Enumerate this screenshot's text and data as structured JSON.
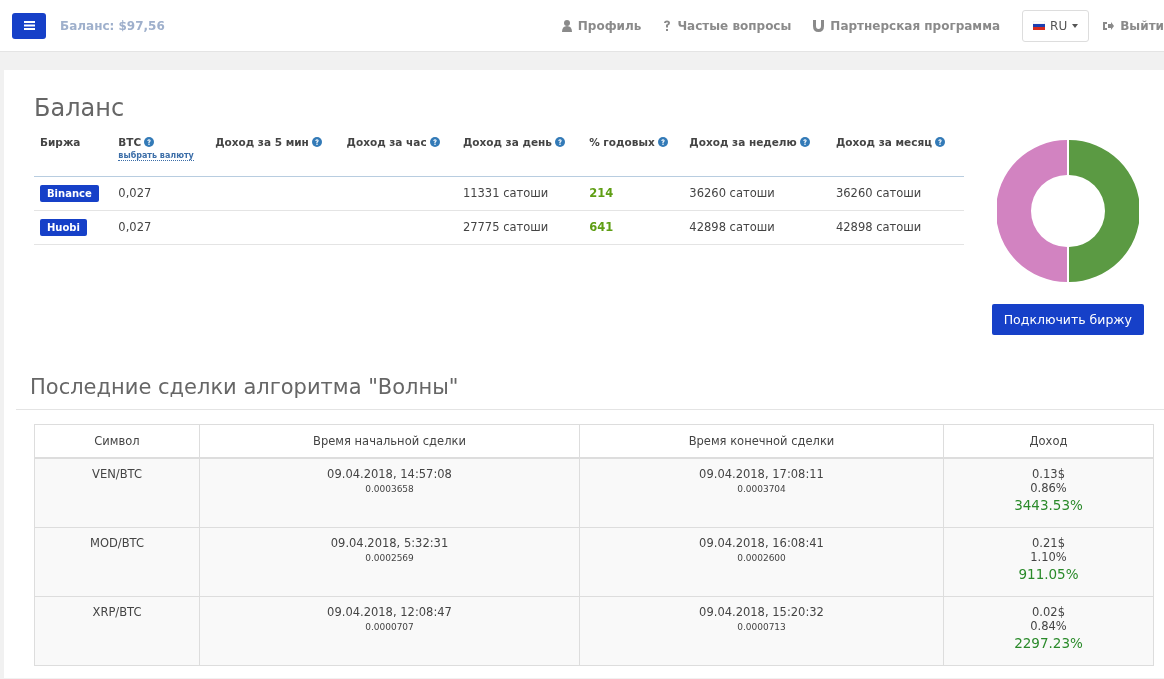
{
  "header": {
    "balance": "Баланс: $97,56",
    "nav": [
      {
        "kind": "profile",
        "label": "Профиль"
      },
      {
        "kind": "faq",
        "label": "Частые вопросы"
      },
      {
        "kind": "partner",
        "label": "Партнерская программа"
      }
    ],
    "language": "RU",
    "logout": "Выйти"
  },
  "balance": {
    "title": "Баланс",
    "columns": [
      {
        "label": "Биржа",
        "help": false
      },
      {
        "label": "BTC",
        "help": true,
        "link": "выбрать валюту"
      },
      {
        "label": "Доход за 5 мин",
        "help": true
      },
      {
        "label": "Доход за час",
        "help": true
      },
      {
        "label": "Доход за день",
        "help": true
      },
      {
        "label": "% годовых",
        "help": true
      },
      {
        "label": "Доход за неделю",
        "help": true
      },
      {
        "label": "Доход за месяц",
        "help": true
      }
    ],
    "rows": [
      {
        "exchange": "Binance",
        "btc": "0,027",
        "day": "11331 сатоши",
        "annual": "214",
        "week": "36260 сатоши",
        "month": "36260 сатоши"
      },
      {
        "exchange": "Huobi",
        "btc": "0,027",
        "day": "27775 сатоши",
        "annual": "641",
        "week": "42898 сатоши",
        "month": "42898 сатоши"
      }
    ],
    "connect_button": "Подключить биржу"
  },
  "trades": {
    "title": "Последние сделки алгоритма \"Волны\"",
    "columns": [
      "Символ",
      "Время начальной сделки",
      "Время конечной сделки",
      "Доход"
    ],
    "rows": [
      {
        "symbol": "VEN/BTC",
        "start_time": "09.04.2018, 14:57:08",
        "start_price": "0.0003658",
        "end_time": "09.04.2018, 17:08:11",
        "end_price": "0.0003704",
        "usd": "0.13$",
        "percent": "0.86%",
        "annual": "3443.53%"
      },
      {
        "symbol": "MOD/BTC",
        "start_time": "09.04.2018, 5:32:31",
        "start_price": "0.0002569",
        "end_time": "09.04.2018, 16:08:41",
        "end_price": "0.0002600",
        "usd": "0.21$",
        "percent": "1.10%",
        "annual": "911.05%"
      },
      {
        "symbol": "XRP/BTC",
        "start_time": "09.04.2018, 12:08:47",
        "start_price": "0.0000707",
        "end_time": "09.04.2018, 15:20:32",
        "end_price": "0.0000713",
        "usd": "0.02$",
        "percent": "0.84%",
        "annual": "2297.23%"
      }
    ]
  }
}
